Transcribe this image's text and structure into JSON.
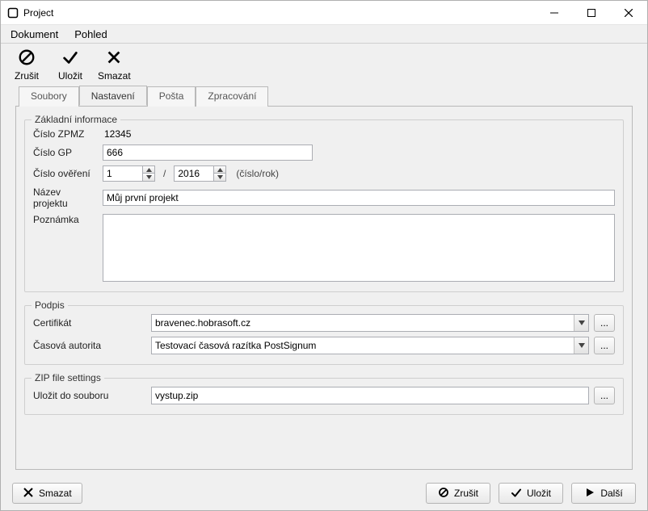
{
  "window": {
    "title": "Project"
  },
  "menu": {
    "dokument": "Dokument",
    "pohled": "Pohled"
  },
  "toolbar": {
    "zrusit": "Zrušit",
    "ulozit": "Uložit",
    "smazat": "Smazat"
  },
  "tabs": {
    "soubory": "Soubory",
    "nastaveni": "Nastavení",
    "posta": "Pošta",
    "zpracovani": "Zpracování"
  },
  "group_info": {
    "legend": "Základní informace",
    "cislo_zpmz_label": "Číslo ZPMZ",
    "cislo_zpmz_value": "12345",
    "cislo_gp_label": "Číslo GP",
    "cislo_gp_value": "666",
    "cislo_overeni_label": "Číslo ověření",
    "ov_num": "1",
    "ov_sep": "/",
    "ov_year": "2016",
    "ov_hint": "(číslo/rok)",
    "nazev_label": "Název projektu",
    "nazev_value": "Můj první projekt",
    "poznamka_label": "Poznámka",
    "poznamka_value": ""
  },
  "group_podpis": {
    "legend": "Podpis",
    "certifikat_label": "Certifikát",
    "certifikat_value": "bravenec.hobrasoft.cz",
    "casova_label": "Časová autorita",
    "casova_value": "Testovací časová razítka PostSignum"
  },
  "group_zip": {
    "legend": "ZIP file settings",
    "ulozit_label": "Uložit do souboru",
    "ulozit_value": "vystup.zip"
  },
  "footer": {
    "smazat": "Smazat",
    "zrusit": "Zrušit",
    "ulozit": "Uložit",
    "dalsi": "Další"
  },
  "ellipsis": "..."
}
